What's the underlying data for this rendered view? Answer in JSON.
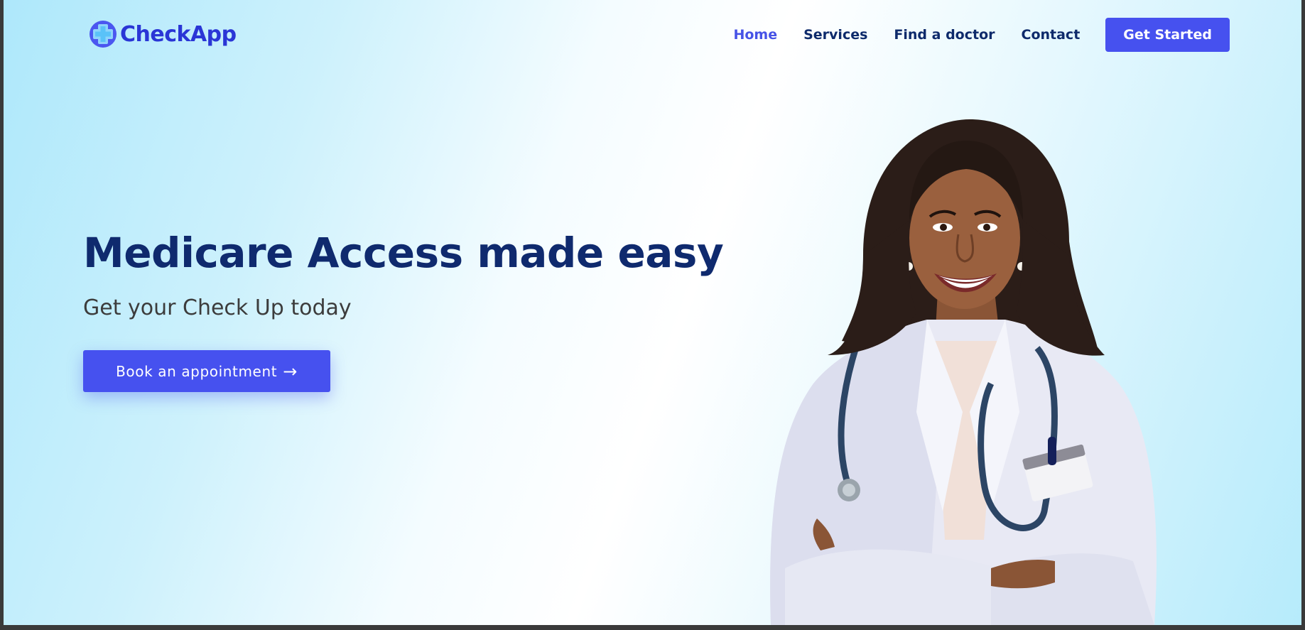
{
  "brand": {
    "name": "CheckApp",
    "logo_icon": "medical-cross-icon",
    "color": "#2a36d6"
  },
  "nav": {
    "items": [
      {
        "label": "Home",
        "active": true
      },
      {
        "label": "Services",
        "active": false
      },
      {
        "label": "Find a doctor",
        "active": false
      },
      {
        "label": "Contact",
        "active": false
      }
    ],
    "cta_label": "Get Started"
  },
  "hero": {
    "title": "Medicare Access made easy",
    "subtitle": "Get your Check Up today",
    "button_label": "Book an appointment",
    "button_icon": "arrow-right-icon"
  },
  "colors": {
    "accent": "#4651ef",
    "heading": "#0f2a6e",
    "nav_text": "#0e2a6b",
    "nav_active": "#4652e6"
  }
}
